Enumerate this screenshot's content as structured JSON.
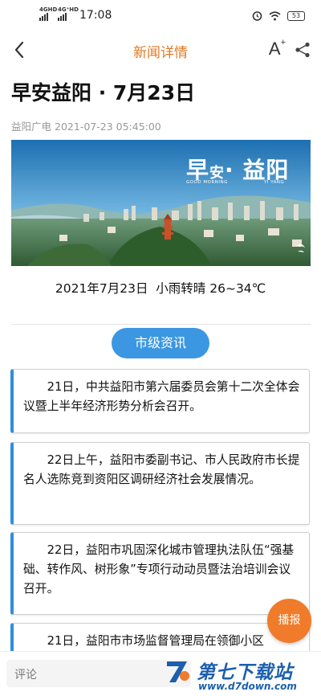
{
  "status_bar": {
    "signal1_label": "4GHD",
    "signal2_label": "4G⁺HD",
    "time": "17:08",
    "battery": "53"
  },
  "nav": {
    "title": "新闻详情",
    "font_label": "A",
    "font_sup": "+"
  },
  "article": {
    "title": "早安益阳 · 7月23日",
    "source": "益阳广电",
    "datetime": "2021-07-23 05:45:00",
    "hero": {
      "title_main1": "早",
      "title_small": "安",
      "title_main2": "· 益阳",
      "sub_left": "GOOD MORNING",
      "sub_right": "YI YANG"
    },
    "weather_line": "2021年7月23日  小雨转晴 26~34℃",
    "section_label": "市级资讯",
    "items": [
      "21日，中共益阳市第六届委员会第十二次全体会议暨上半年经济形势分析会召开。",
      "22日上午，益阳市委副书记、市人民政府市长提名人选陈竞到资阳区调研经济社会发展情况。",
      "22日，益阳市巩固深化城市管理执法队伍“强基础、转作风、树形象”专项行动动员暨法治培训会议召开。",
      "21日，益阳市市场监督管理局在领御小区"
    ]
  },
  "play_button": "播报",
  "comment": {
    "placeholder": "评论"
  },
  "watermark": {
    "title": "第七下载站",
    "url": "www.d7down.com"
  },
  "colors": {
    "accent_orange": "#e07a24",
    "accent_blue": "#2f8fdd",
    "play_orange": "#f07b2a"
  }
}
